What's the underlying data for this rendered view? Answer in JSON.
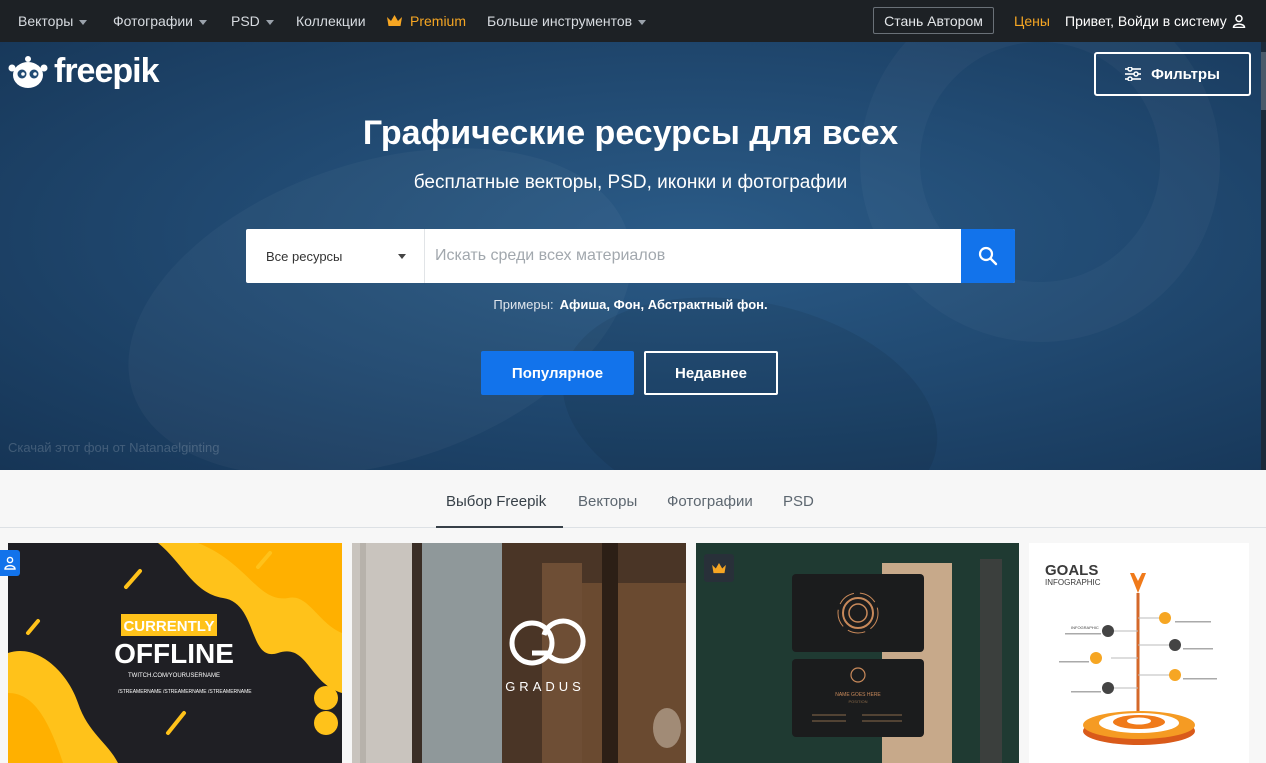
{
  "nav": {
    "items": [
      {
        "label": "Векторы",
        "dropdown": true
      },
      {
        "label": "Фотографии",
        "dropdown": true
      },
      {
        "label": "PSD",
        "dropdown": true
      },
      {
        "label": "Коллекции",
        "dropdown": false
      },
      {
        "label": "Premium",
        "dropdown": false
      },
      {
        "label": "Больше инструментов",
        "dropdown": true
      }
    ],
    "author_button": "Стань Автором",
    "prices": "Цены",
    "login": "Привет, Войди в систему"
  },
  "brand": {
    "name": "freepik"
  },
  "hero": {
    "filters_button": "Фильтры",
    "title": "Графические ресурсы для всех",
    "subtitle": "бесплатные векторы, PSD, иконки и фотографии",
    "search": {
      "category": "Все ресурсы",
      "placeholder": "Искать среди всех материалов"
    },
    "examples_label": "Примеры:",
    "examples": "Афиша, Фон, Абстрактный фон.",
    "popular_button": "Популярное",
    "recent_button": "Недавнее",
    "credit": "Скачай этот фон от Natanaelginting"
  },
  "tabs": [
    "Выбор Freepik",
    "Векторы",
    "Фотографии",
    "PSD"
  ],
  "cards": {
    "offline": {
      "line1": "CURRENTLY",
      "line2": "OFFLINE",
      "url": "TWITCH.COM/YOURUSERNAME",
      "socials": [
        "/STREAMERNAME",
        "/STREAMERNAME",
        "/STREAMERNAME"
      ]
    },
    "gradus": {
      "brand": "GRADUS"
    },
    "business_card": {
      "name": "NAME GOES HERE",
      "role": "POSITION"
    },
    "infographic": {
      "title": "GOALS",
      "subtitle": "INFOGRAPHIC",
      "label": "INFOGRAPHIC"
    }
  },
  "colors": {
    "accent": "#1273eb",
    "premium": "#f6a623",
    "topbar": "#1d2125",
    "hero": "#214a72"
  }
}
